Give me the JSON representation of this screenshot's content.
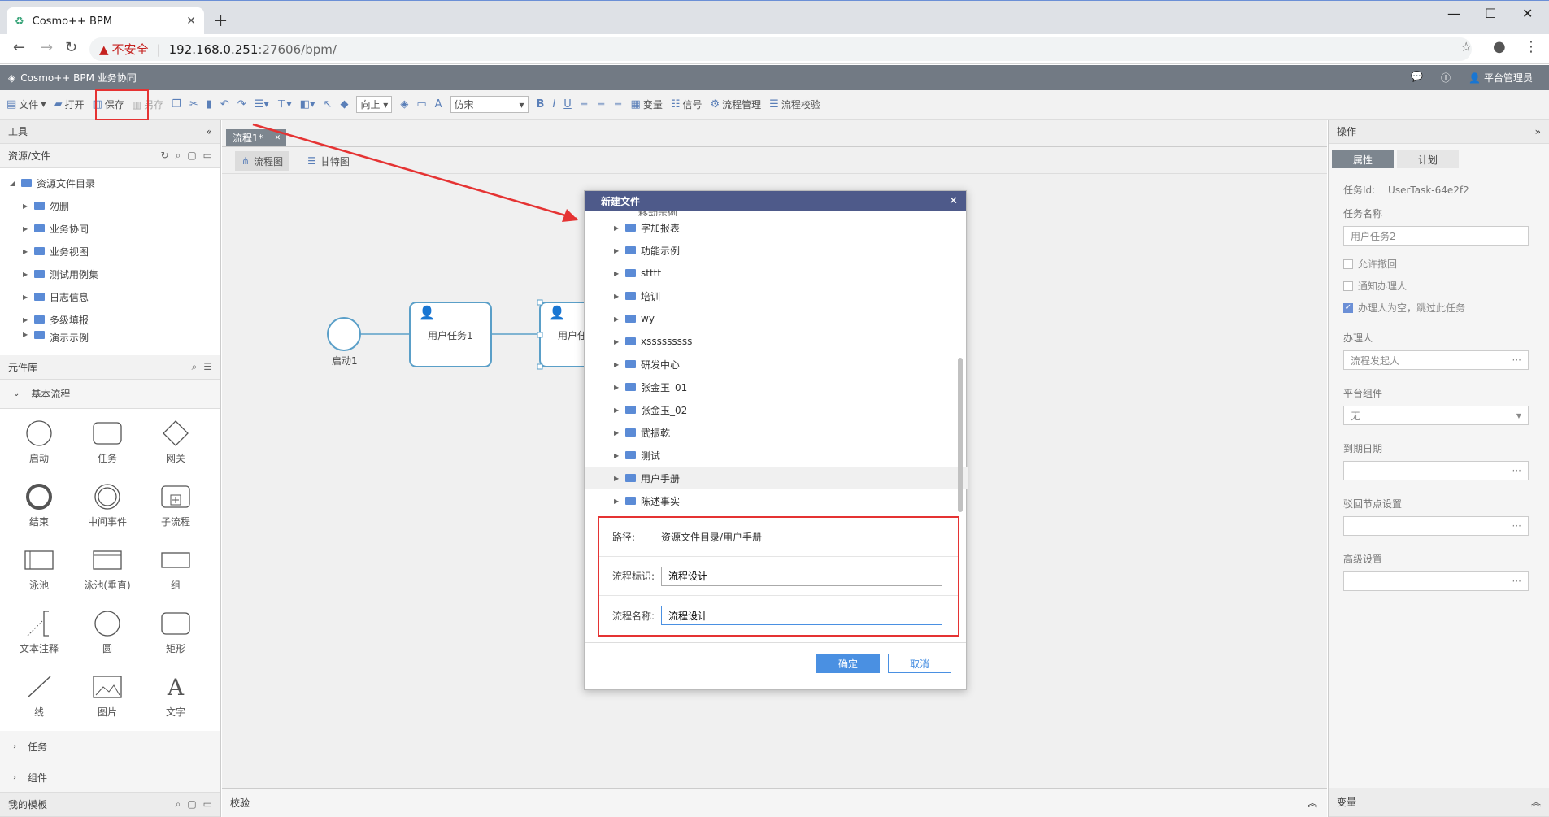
{
  "browser": {
    "tab_title": "Cosmo++ BPM",
    "new_tab": "+",
    "insecure": "不安全",
    "url_host": "192.168.0.251",
    "url_path": ":27606/bpm/"
  },
  "app": {
    "title": "Cosmo++ BPM 业务协同",
    "user": "平台管理员"
  },
  "toolbar": {
    "file": "文件",
    "open": "打开",
    "save": "保存",
    "saveas": "另存",
    "direction": "向上",
    "font": "仿宋",
    "variables": "变量",
    "signals": "信号",
    "process_mgmt": "流程管理",
    "process_check": "流程校验"
  },
  "left": {
    "tools_title": "工具",
    "resources_title": "资源/文件",
    "tree_root": "资源文件目录",
    "tree_items": [
      "勿删",
      "业务协同",
      "业务视图",
      "测试用例集",
      "日志信息",
      "多级填报",
      "演示示例"
    ],
    "library_title": "元件库",
    "basic_group": "基本流程",
    "shapes": [
      "启动",
      "任务",
      "网关",
      "结束",
      "中间事件",
      "子流程",
      "泳池",
      "泳池(垂直)",
      "组",
      "文本注释",
      "圆",
      "矩形",
      "线",
      "图片",
      "文字"
    ],
    "task_group": "任务",
    "component_group": "组件",
    "templates_title": "我的模板"
  },
  "canvas": {
    "doc_tab": "流程1*",
    "tab_flow": "流程图",
    "tab_gantt": "甘特图",
    "start_label": "启动1",
    "task1_label": "用户任务1",
    "task2_label": "用户任",
    "bottom_label": "校验"
  },
  "right": {
    "title": "操作",
    "tab_props": "属性",
    "tab_plan": "计划",
    "task_id_label": "任务Id:",
    "task_id": "UserTask-64e2f2",
    "task_name_label": "任务名称",
    "task_name": "用户任务2",
    "check_withdraw": "允许撤回",
    "check_notify": "通知办理人",
    "check_skip": "办理人为空，跳过此任务",
    "handler_label": "办理人",
    "handler_value": "流程发起人",
    "component_label": "平台组件",
    "component_value": "无",
    "due_label": "到期日期",
    "reject_label": "驳回节点设置",
    "advanced_label": "高级设置",
    "bottom_title": "变量"
  },
  "modal": {
    "title": "新建文件",
    "partial_top": "移动示例",
    "folders": [
      "字加报表",
      "功能示例",
      "stttt",
      "培训",
      "wy",
      "xsssssssss",
      "研发中心",
      "张金玉_01",
      "张金玉_02",
      "武振乾",
      "测试",
      "用户手册",
      "陈述事实"
    ],
    "path_label": "路径:",
    "path_value": "资源文件目录/用户手册",
    "id_label": "流程标识:",
    "id_value": "流程设计",
    "name_label": "流程名称:",
    "name_value": "流程设计",
    "ok": "确定",
    "cancel": "取消"
  },
  "colors": {
    "accent": "#4a90e2",
    "highlight": "#e53333",
    "header": "#727a84",
    "modal_header": "#4e5a8a"
  }
}
